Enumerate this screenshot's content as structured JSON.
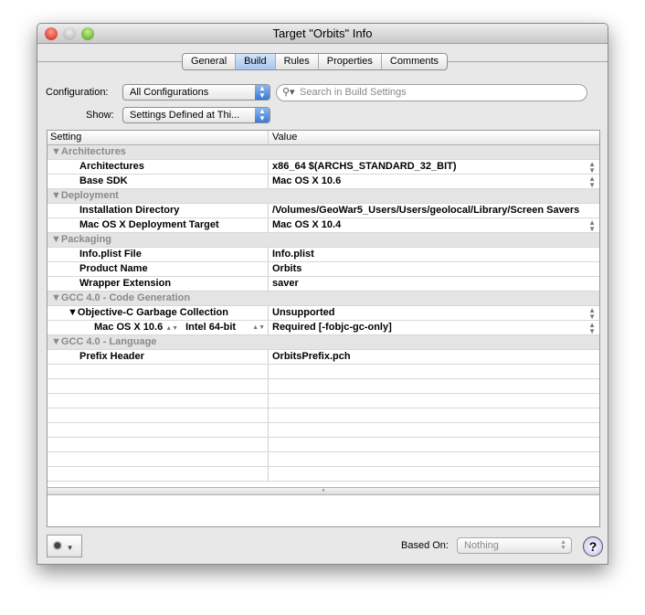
{
  "window": {
    "title": "Target \"Orbits\" Info"
  },
  "tabs": [
    {
      "label": "General"
    },
    {
      "label": "Build",
      "active": true
    },
    {
      "label": "Rules"
    },
    {
      "label": "Properties"
    },
    {
      "label": "Comments"
    }
  ],
  "configuration": {
    "label": "Configuration:",
    "value": "All Configurations"
  },
  "search": {
    "placeholder": "Search in Build Settings"
  },
  "show": {
    "label": "Show:",
    "value": "Settings Defined at Thi..."
  },
  "table": {
    "headers": [
      "Setting",
      "Value"
    ],
    "rows": [
      {
        "type": "group",
        "label": "▼Architectures"
      },
      {
        "type": "setting",
        "setting": "Architectures",
        "value": "x86_64 $(ARCHS_STANDARD_32_BIT)",
        "stepper": true
      },
      {
        "type": "setting",
        "setting": "Base SDK",
        "value": "Mac OS X 10.6",
        "stepper": true
      },
      {
        "type": "group",
        "label": "▼Deployment"
      },
      {
        "type": "setting",
        "setting": "Installation Directory",
        "value": "/Volumes/GeoWar5_Users/Users/geolocal/Library/Screen Savers"
      },
      {
        "type": "setting",
        "setting": "Mac OS X Deployment Target",
        "value": "Mac OS X 10.4",
        "stepper": true
      },
      {
        "type": "group",
        "label": "▼Packaging"
      },
      {
        "type": "setting",
        "setting": "Info.plist File",
        "value": "Info.plist"
      },
      {
        "type": "setting",
        "setting": "Product Name",
        "value": "Orbits"
      },
      {
        "type": "setting",
        "setting": "Wrapper Extension",
        "value": "saver"
      },
      {
        "type": "group",
        "label": "▼GCC 4.0 - Code Generation"
      },
      {
        "type": "setting",
        "setting": "▼Objective-C Garbage Collection",
        "value": "Unsupported",
        "stepper": true
      },
      {
        "type": "condition",
        "sdk": "Mac OS X 10.6",
        "arch": "Intel 64-bit",
        "value": "Required [-fobjc-gc-only]",
        "stepper": true
      },
      {
        "type": "group",
        "label": "▼GCC 4.0 - Language"
      },
      {
        "type": "setting",
        "setting": "Prefix Header",
        "value": "OrbitsPrefix.pch"
      }
    ]
  },
  "footer": {
    "based_on_label": "Based On:",
    "based_on_value": "Nothing",
    "help": "?"
  }
}
